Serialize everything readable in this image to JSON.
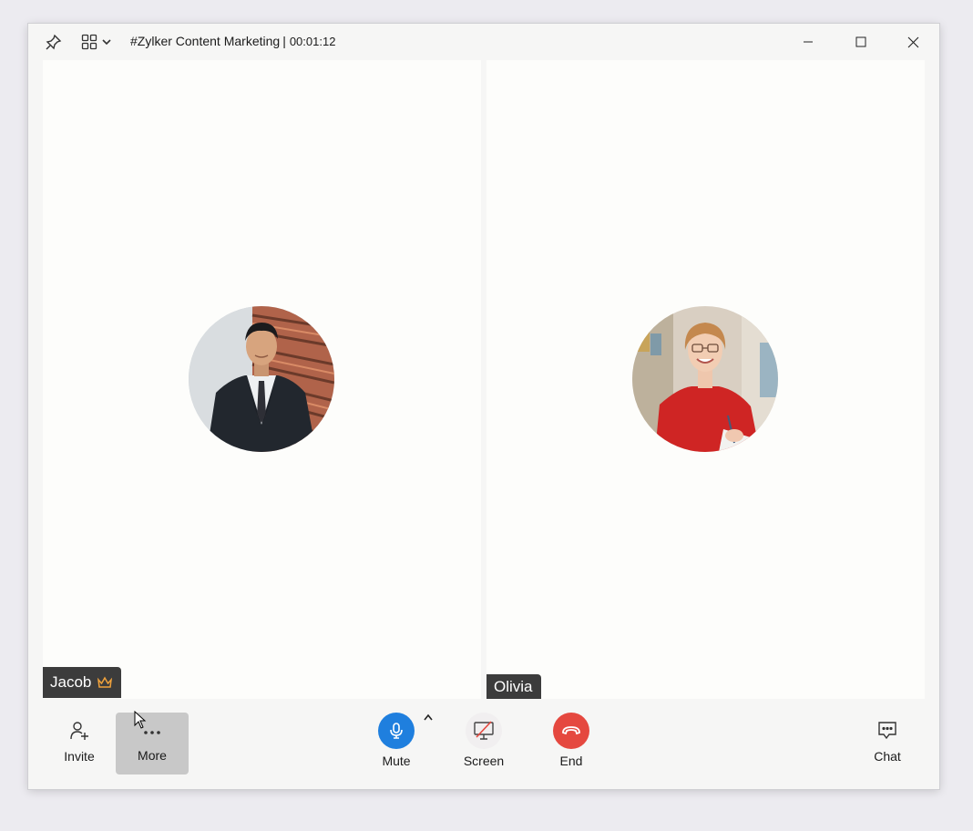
{
  "window": {
    "title": "#Zylker Content Marketing",
    "separator": "|",
    "timer": "00:01:12"
  },
  "participants": [
    {
      "name": "Jacob",
      "role_icon": "crown-icon"
    },
    {
      "name": "Olivia"
    }
  ],
  "controls": {
    "invite_label": "Invite",
    "more_label": "More",
    "mute_label": "Mute",
    "screen_label": "Screen",
    "end_label": "End",
    "chat_label": "Chat"
  },
  "colors": {
    "mute": "#1f7fde",
    "end": "#e5483f",
    "crown": "#f0a23c"
  }
}
